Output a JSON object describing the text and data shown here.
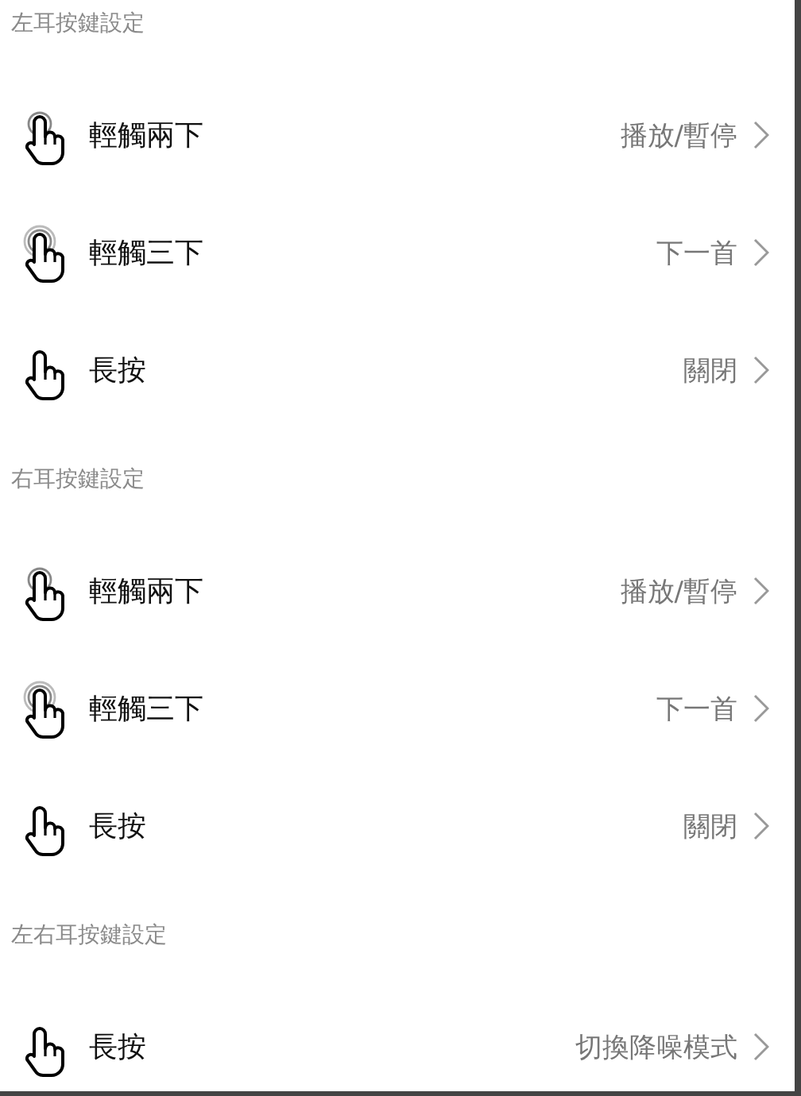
{
  "sections": [
    {
      "title": "左耳按鍵設定",
      "rows": [
        {
          "kind": "double_tap",
          "label": "輕觸兩下",
          "value": "播放/暫停"
        },
        {
          "kind": "triple_tap",
          "label": "輕觸三下",
          "value": "下一首"
        },
        {
          "kind": "long_press",
          "label": "長按",
          "value": "關閉"
        }
      ]
    },
    {
      "title": "右耳按鍵設定",
      "rows": [
        {
          "kind": "double_tap",
          "label": "輕觸兩下",
          "value": "播放/暫停"
        },
        {
          "kind": "triple_tap",
          "label": "輕觸三下",
          "value": "下一首"
        },
        {
          "kind": "long_press",
          "label": "長按",
          "value": "關閉"
        }
      ]
    },
    {
      "title": "左右耳按鍵設定",
      "rows": [
        {
          "kind": "long_press",
          "label": "長按",
          "value": "切換降噪模式"
        }
      ]
    }
  ]
}
